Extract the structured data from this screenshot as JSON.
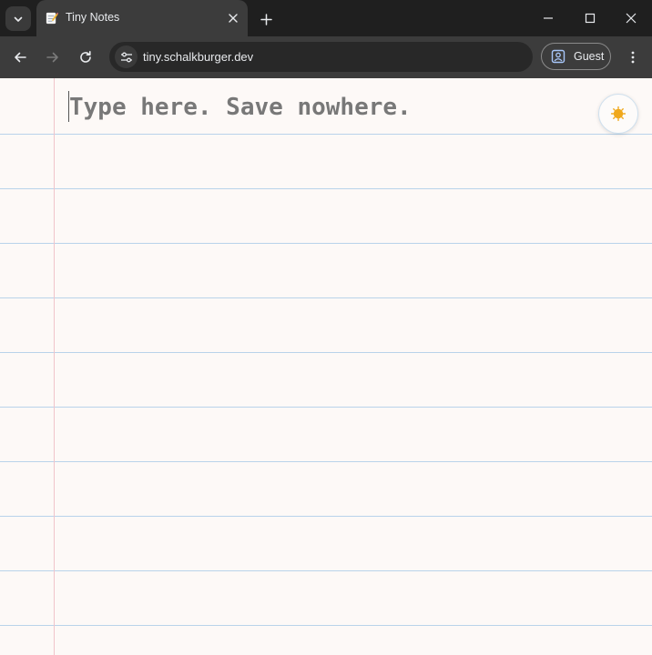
{
  "browser": {
    "tab": {
      "title": "Tiny Notes",
      "favicon": "memo-icon"
    },
    "address": {
      "url": "tiny.schalkburger.dev"
    },
    "profile": {
      "label": "Guest"
    }
  },
  "note": {
    "placeholder": "Type here. Save nowhere.",
    "value": ""
  },
  "theme_toggle": {
    "icon": "sun-icon",
    "color": "#f0a81c"
  },
  "colors": {
    "paper": "#fdf9f7",
    "rule_line": "#b9d3ea",
    "margin_line": "#f0c4cb"
  }
}
